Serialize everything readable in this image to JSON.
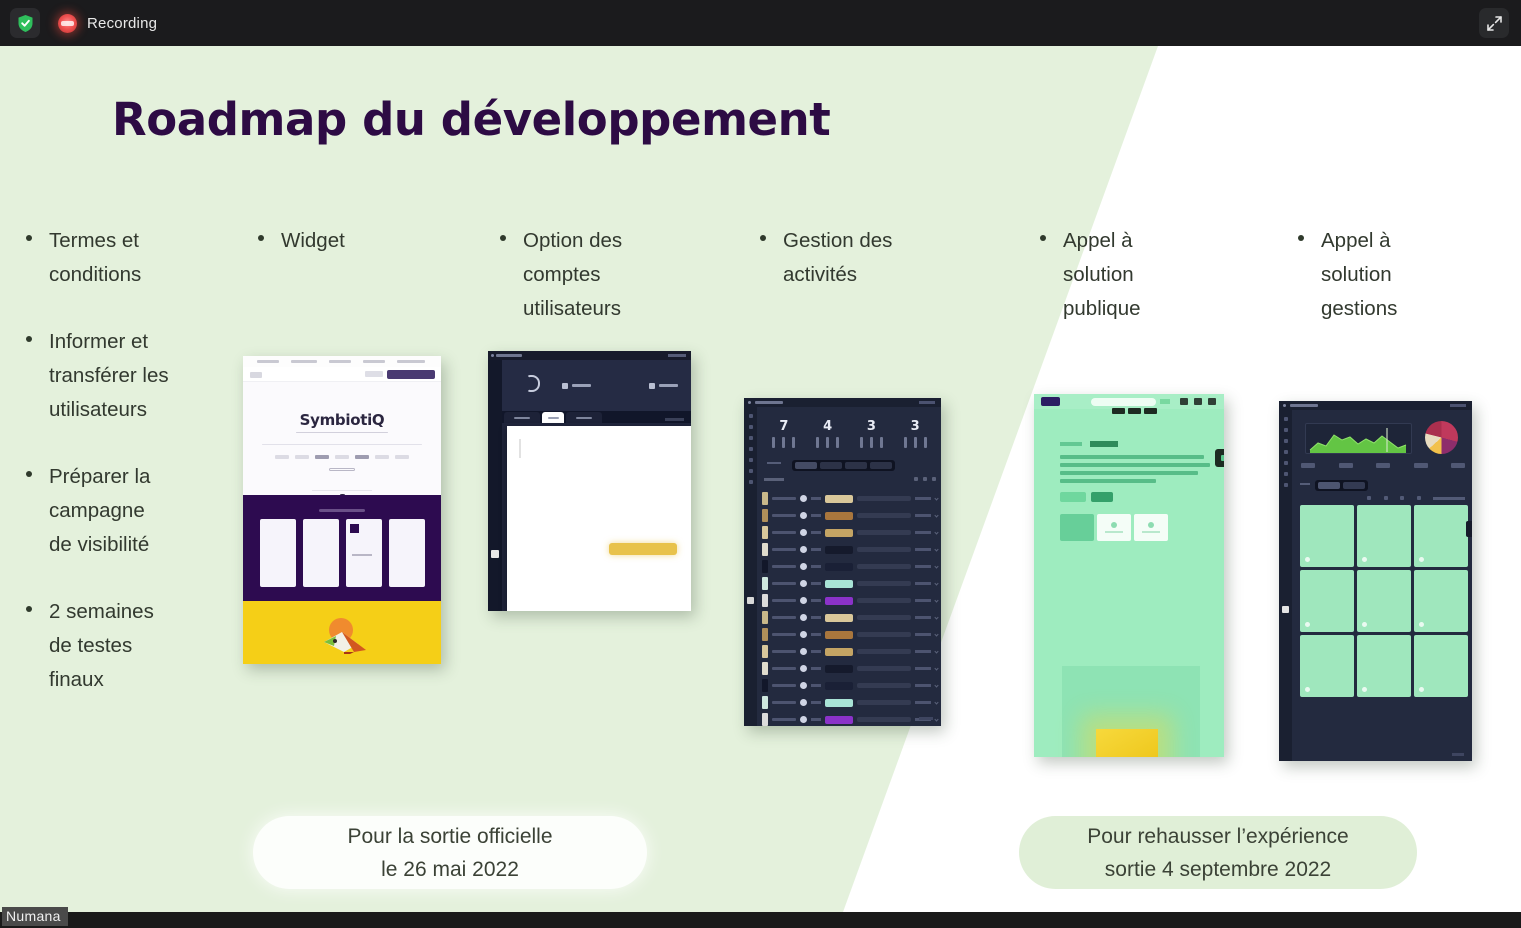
{
  "recorder": {
    "shield_icon": "shield-check-icon",
    "record_icon": "record-dot-icon",
    "status_label": "Recording",
    "expand_icon": "expand-diagonal-icon"
  },
  "slide": {
    "title": "Roadmap du développement",
    "watermark": "Numana",
    "colors": {
      "background_green": "#e4f1dc",
      "background_white": "#ffffff",
      "title_purple": "#2d0b44",
      "body_text": "#32392f",
      "accent_yellow": "#f5cf17",
      "accent_mint": "#9eecbf",
      "dark_panel": "#232a3f",
      "deep_purple": "#2d0b50"
    },
    "columns": [
      {
        "name": "column-terms",
        "bullets": [
          "Termes et\nconditions",
          "Informer et\ntransférer les\nutilisateurs",
          "Préparer la\ncampagne\nde visibilité",
          "2 semaines\nde testes\nfinaux"
        ]
      },
      {
        "name": "column-widget",
        "bullets": [
          "Widget"
        ]
      },
      {
        "name": "column-user-accounts",
        "bullets": [
          "Option des\ncomptes\nutilisateurs"
        ]
      },
      {
        "name": "column-activities",
        "bullets": [
          "Gestion des\nactivités"
        ]
      },
      {
        "name": "column-public-solution",
        "bullets": [
          "Appel à\nsolution\npublique"
        ]
      },
      {
        "name": "column-solution-management",
        "bullets": [
          "Appel à\nsolution\ngestions"
        ]
      }
    ],
    "captions": [
      {
        "name": "caption-official-release",
        "line1": "Pour la sortie officielle",
        "line2": "le 26 mai 2022"
      },
      {
        "name": "caption-enhanced-experience",
        "line1": "Pour rehausser l’expérience",
        "line2": "sortie 4 septembre 2022"
      }
    ],
    "mockups": {
      "website": {
        "name": "symbiotiq-website-mockup",
        "brand": "SymbiotiQ"
      },
      "accounts": {
        "name": "user-accounts-form-mockup"
      },
      "activities": {
        "name": "activities-dashboard-mockup",
        "stats": [
          "7",
          "4",
          "3",
          "3"
        ]
      },
      "public": {
        "name": "public-solution-page-mockup"
      },
      "management": {
        "name": "solution-management-dashboard-mockup"
      }
    }
  }
}
